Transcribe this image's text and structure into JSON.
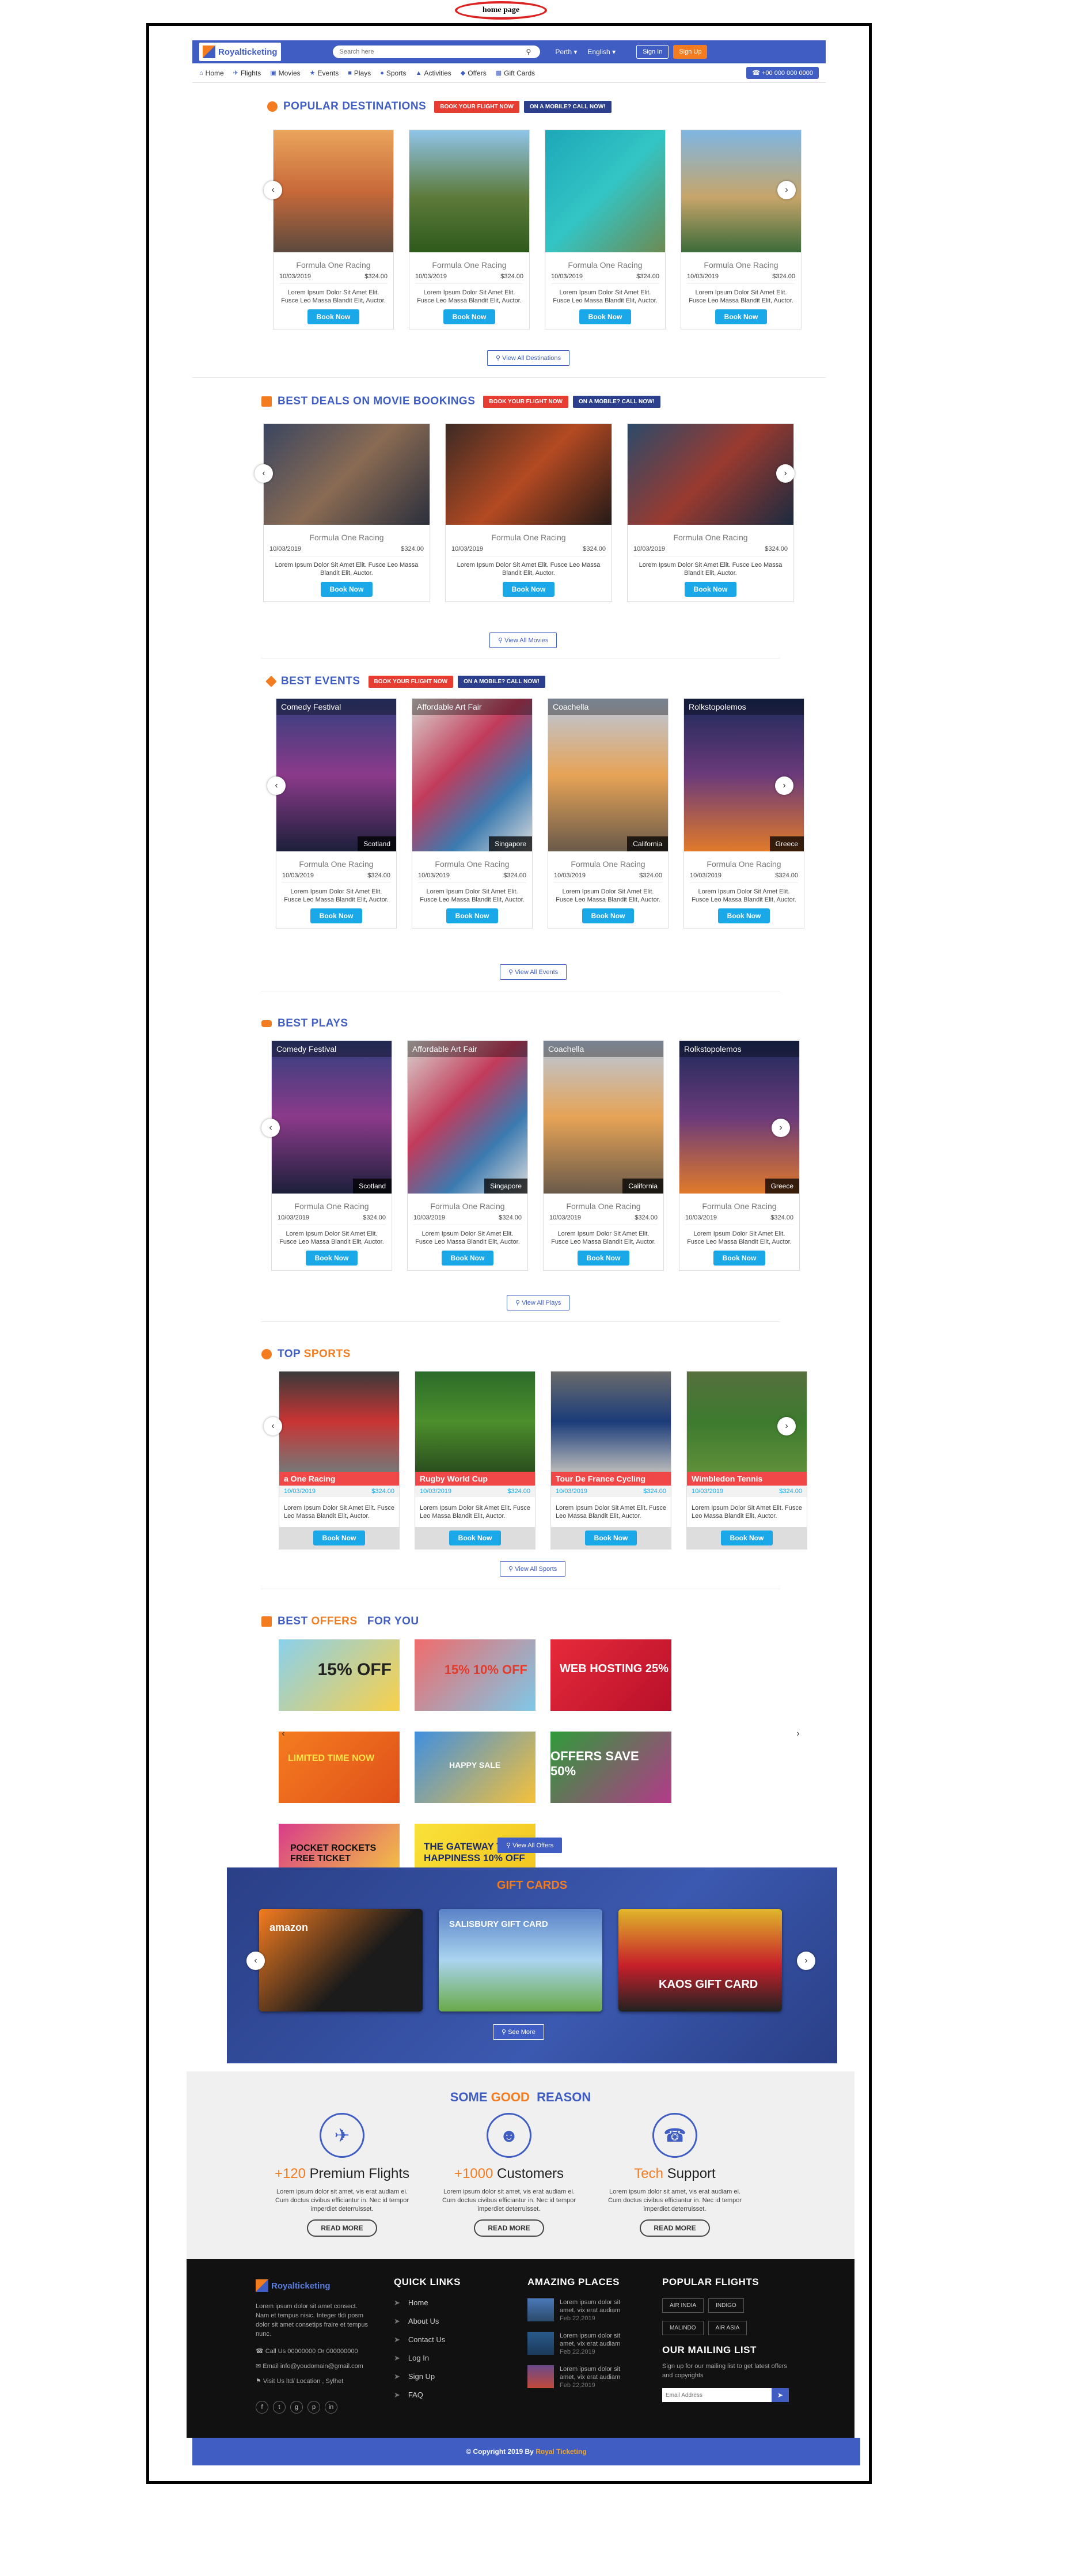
{
  "page_label": "home page",
  "header": {
    "logo": "Royalticketing",
    "search_placeholder": "Search here",
    "city": "Perth",
    "language": "English",
    "signin": "Sign In",
    "signup": "Sign Up",
    "phone": "+00 000 000 0000"
  },
  "nav": [
    "Home",
    "Flights",
    "Movies",
    "Events",
    "Plays",
    "Sports",
    "Activities",
    "Offers",
    "Gift Cards"
  ],
  "common": {
    "card_title": "Formula One Racing",
    "date": "10/03/2019",
    "price": "$324.00",
    "desc": "Lorem Ipsum Dolor Sit Amet Elit. Fusce Leo Massa Blandit Elit, Auctor.",
    "book": "Book Now",
    "tag_flight": "BOOK YOUR FLIGHT NOW",
    "tag_call": "ON A MOBILE? CALL NOW!"
  },
  "destinations": {
    "title_a": "POPULAR",
    "title_b": "DESTINATIONS",
    "view_all": "View All Destinations"
  },
  "movies": {
    "title_a": "BEST DEALS ON",
    "title_b": "MOVIE BOOKINGS",
    "view_all": "View All Movies"
  },
  "events": {
    "title_a": "BEST",
    "title_b": "EVENTS",
    "view_all": "View All Events",
    "items": [
      {
        "name": "Comedy Festival",
        "loc": "Scotland"
      },
      {
        "name": "Affordable Art Fair",
        "loc": "Singapore"
      },
      {
        "name": "Coachella",
        "loc": "California"
      },
      {
        "name": "Rolkstopolemos",
        "loc": "Greece"
      }
    ]
  },
  "plays": {
    "title_a": "BEST",
    "title_b": "PLAYS",
    "view_all": "View All Plays"
  },
  "sports": {
    "title_a": "TOP",
    "title_b": "SPORTS",
    "view_all": "View All Sports",
    "items": [
      "a One Racing",
      "Rugby World Cup",
      "Tour De France Cycling",
      "Wimbledon Tennis"
    ]
  },
  "offers": {
    "title_a": "BEST",
    "title_b": "OFFERS",
    "title_c": "FOR YOU",
    "view_all": "View All Offers",
    "tiles": [
      "15% OFF",
      "15% 10% OFF",
      "WEB HOSTING 25%",
      "LIMITED TIME NOW",
      "HAPPY SALE",
      "OFFERS SAVE 50%",
      "POCKET ROCKETS FREE TICKET",
      "THE GATEWAY TO HAPPINESS 10% OFF"
    ]
  },
  "gift": {
    "title": "GIFT CARDS",
    "cards": [
      "amazon",
      "SALISBURY GIFT CARD",
      "KAOS GIFT CARD"
    ],
    "see_more": "See More"
  },
  "reason": {
    "title_a": "SOME",
    "title_b": "GOOD",
    "title_c": "REASON",
    "features": [
      {
        "num": "+120",
        "label": "Premium Flights"
      },
      {
        "num": "+1000",
        "label": "Customers"
      },
      {
        "num": "Tech",
        "label": "Support"
      }
    ],
    "desc": "Lorem ipsum dolor sit amet, vis erat audiam ei. Cum doctus civibus efficiantur in. Nec id tempor imperdiet deterruisset.",
    "read_more": "READ MORE"
  },
  "footer": {
    "logo": "Royalticketing",
    "about": "Lorem ipsum dolor sit amet consect. Nam et tempus nisic. Integer tldi posm dolor sit amet consetips fraire et tempus nunc.",
    "phone": "Call Us 00000000 Or 000000000",
    "email": "Email info@youdomain@gmail.com",
    "address": "Visit Us ltd/ Location , Sylhet",
    "quick_h": "QUICK LINKS",
    "links": [
      "Home",
      "About Us",
      "Contact Us",
      "Log In",
      "Sign Up",
      "FAQ"
    ],
    "places_h": "AMAZING PLACES",
    "place_text": "Lorem ipsum dolor sit amet, vix erat audiam",
    "place_date": "Feb 22,2019",
    "flights_h": "POPULAR FLIGHTS",
    "flights": [
      "AIR INDIA",
      "INDIGO",
      "MALINDO",
      "AIR ASIA"
    ],
    "mail_h": "OUR MAILING LIST",
    "mail_p": "Sign up for our mailing list to get latest offers and copyrights",
    "mail_ph": "Email Address",
    "copyright_a": "© Copyright 2019 By",
    "copyright_b": "Royal Ticketing"
  },
  "colors": {
    "brand": "#3f5dc2",
    "accent": "#f47c20",
    "book": "#1ba8e8"
  }
}
